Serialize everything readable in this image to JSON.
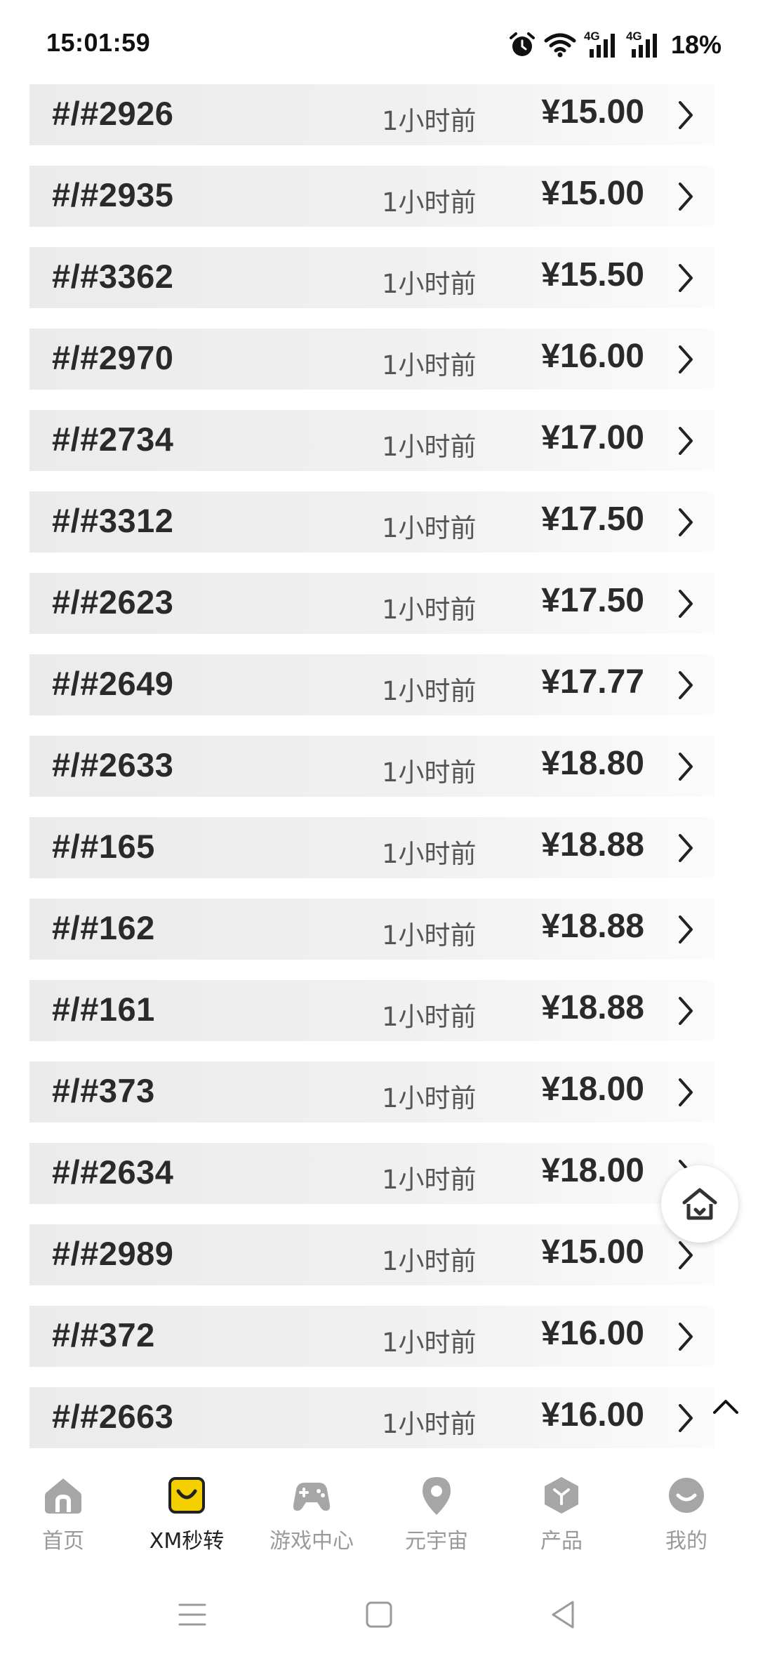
{
  "status_bar": {
    "time": "15:01:59",
    "network_1": "4G",
    "network_2": "4G",
    "battery": "18%",
    "icons": [
      "alarm-icon",
      "wifi-icon",
      "signal-icon",
      "signal-icon",
      "battery-text"
    ]
  },
  "list": {
    "items": [
      {
        "id": "#/#2926",
        "time": "1小时前",
        "price": "¥15.00"
      },
      {
        "id": "#/#2935",
        "time": "1小时前",
        "price": "¥15.00"
      },
      {
        "id": "#/#3362",
        "time": "1小时前",
        "price": "¥15.50"
      },
      {
        "id": "#/#2970",
        "time": "1小时前",
        "price": "¥16.00"
      },
      {
        "id": "#/#2734",
        "time": "1小时前",
        "price": "¥17.00"
      },
      {
        "id": "#/#3312",
        "time": "1小时前",
        "price": "¥17.50"
      },
      {
        "id": "#/#2623",
        "time": "1小时前",
        "price": "¥17.50"
      },
      {
        "id": "#/#2649",
        "time": "1小时前",
        "price": "¥17.77"
      },
      {
        "id": "#/#2633",
        "time": "1小时前",
        "price": "¥18.80"
      },
      {
        "id": "#/#165",
        "time": "1小时前",
        "price": "¥18.88"
      },
      {
        "id": "#/#162",
        "time": "1小时前",
        "price": "¥18.88"
      },
      {
        "id": "#/#161",
        "time": "1小时前",
        "price": "¥18.88"
      },
      {
        "id": "#/#373",
        "time": "1小时前",
        "price": "¥18.00"
      },
      {
        "id": "#/#2634",
        "time": "1小时前",
        "price": "¥18.00"
      },
      {
        "id": "#/#2989",
        "time": "1小时前",
        "price": "¥15.00"
      },
      {
        "id": "#/#372",
        "time": "1小时前",
        "price": "¥16.00"
      },
      {
        "id": "#/#2663",
        "time": "1小时前",
        "price": "¥16.00"
      }
    ]
  },
  "bottom_nav": {
    "items": [
      {
        "label": "首页",
        "icon": "home-icon",
        "active": false
      },
      {
        "label": "XM秒转",
        "icon": "shopping-bag-icon",
        "active": true
      },
      {
        "label": "游戏中心",
        "icon": "gamepad-icon",
        "active": false
      },
      {
        "label": "元宇宙",
        "icon": "location-pin-icon",
        "active": false
      },
      {
        "label": "产品",
        "icon": "hexagon-icon",
        "active": false
      },
      {
        "label": "我的",
        "icon": "smile-icon",
        "active": false
      }
    ]
  },
  "colors": {
    "accent": "#f5d000",
    "inactive": "#9a9a9a",
    "text_dark": "#2a2a2a"
  }
}
